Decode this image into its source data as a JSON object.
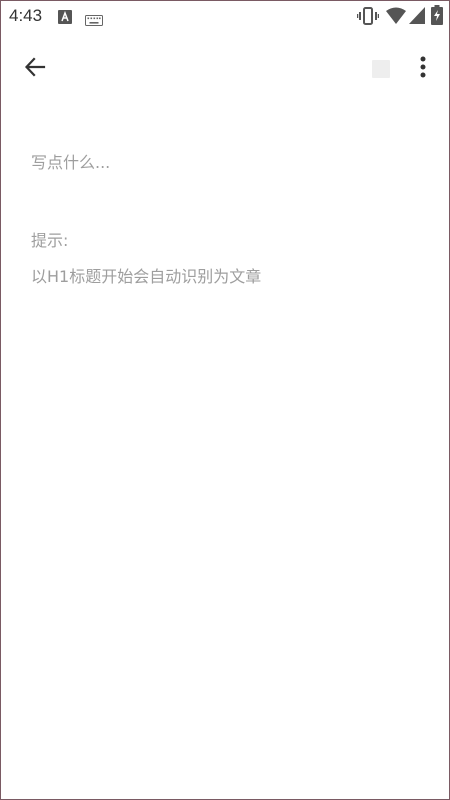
{
  "status_bar": {
    "time": "4:43",
    "icons": [
      "app-a-icon",
      "keyboard-icon",
      "vibrate-icon",
      "wifi-icon",
      "signal-icon",
      "battery-icon"
    ]
  },
  "toolbar": {
    "back_icon": "arrow-left-icon",
    "square_icon": "square-icon",
    "more_icon": "more-vert-icon"
  },
  "editor": {
    "placeholder": "写点什么...",
    "hint_label": "提示:",
    "hint_text": "以H1标题开始会自动识别为文章"
  },
  "colors": {
    "text_hint": "#9e9e9e",
    "icon": "#333333",
    "frame_border": "#7a5a63"
  }
}
